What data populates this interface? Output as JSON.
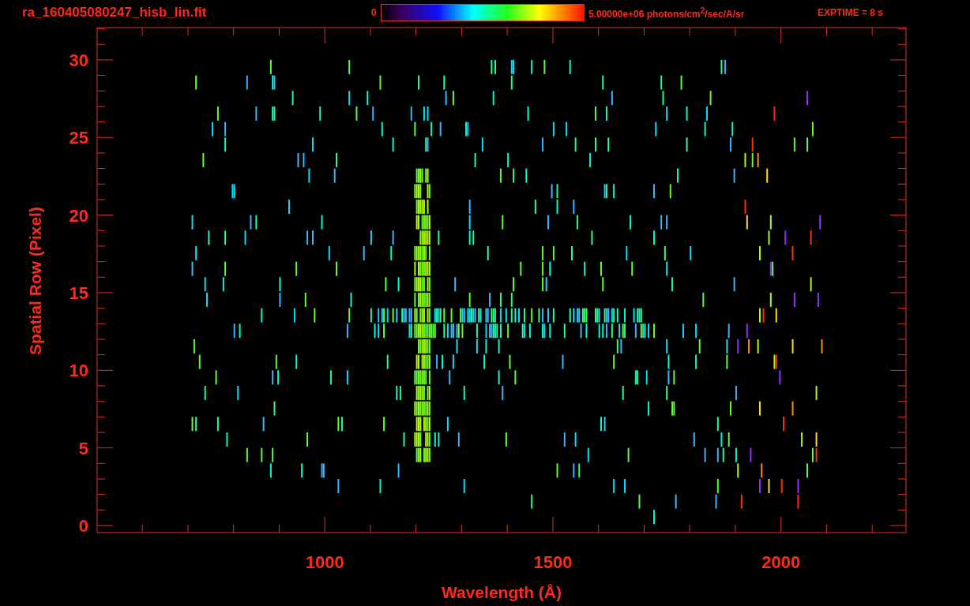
{
  "header": {
    "filename": "ra_160405080247_hisb_lin.fit",
    "colorbar": {
      "min_label": "0",
      "max_label": "5.00000e+06 photons/cm$^{2}$/sec/A/sr"
    },
    "exposure": "EXPTIME = 8 s"
  },
  "plot": {
    "xlabel": "Wavelength (Å)",
    "ylabel": "Spatial Row (Pixel)",
    "xticks": [
      "1000",
      "1500",
      "2000"
    ],
    "yticks": [
      "30",
      "25",
      "20",
      "15",
      "10",
      "5",
      "0"
    ]
  }
}
